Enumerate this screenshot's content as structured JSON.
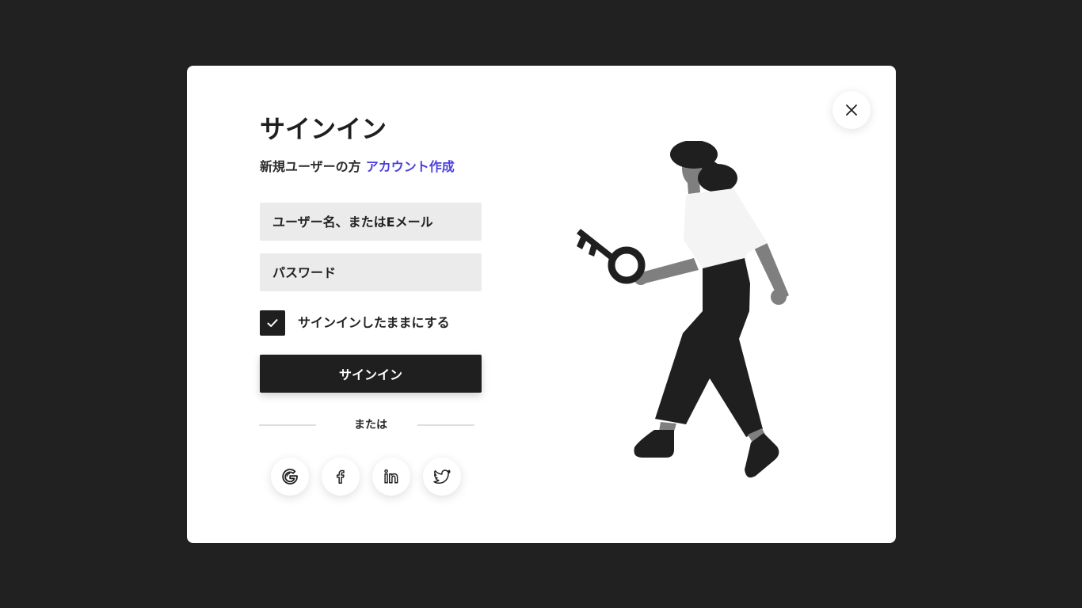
{
  "modal": {
    "title": "サインイン",
    "new_user_text": "新規ユーザーの方",
    "create_account_link": "アカウント作成"
  },
  "form": {
    "username_placeholder": "ユーザー名、またはEメール",
    "username_value": "",
    "password_placeholder": "パスワード",
    "password_value": "",
    "remember_label": "サインインしたままにする",
    "remember_checked": true,
    "submit_label": "サインイン"
  },
  "divider": {
    "label": "または"
  },
  "social": [
    {
      "icon": "google-icon"
    },
    {
      "icon": "facebook-icon"
    },
    {
      "icon": "linkedin-icon"
    },
    {
      "icon": "twitter-icon"
    }
  ],
  "colors": {
    "backdrop": "#212121",
    "accent_link": "#4b3fe0",
    "primary_button": "#1f1f1f",
    "input_background": "#ebebeb"
  }
}
